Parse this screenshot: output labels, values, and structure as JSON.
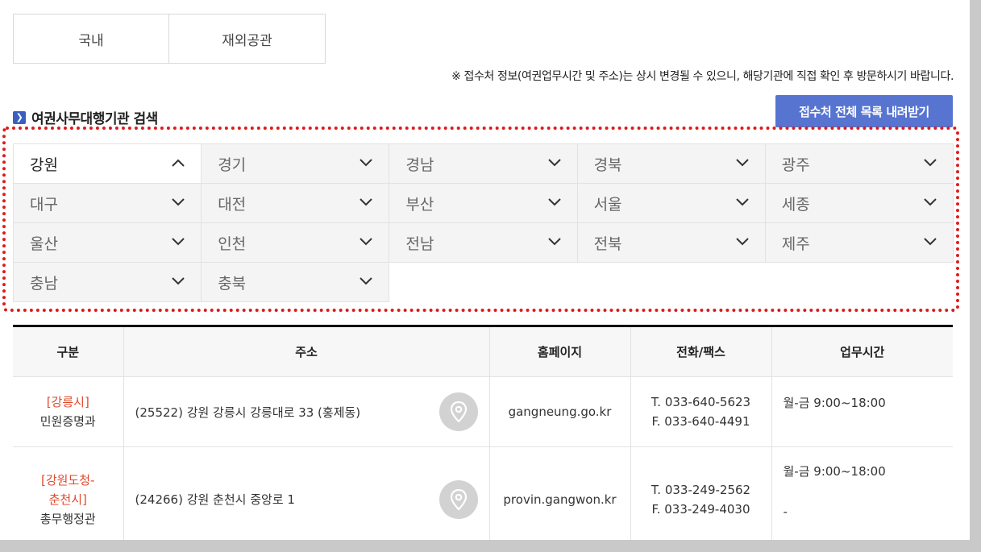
{
  "tabs": [
    {
      "label": "국내"
    },
    {
      "label": "재외공관"
    }
  ],
  "notice": "※ 접수처 정보(여권업무시간 및 주소)는 상시 변경될 수 있으니, 해당기관에 직접 확인 후 방문하시기 바랍니다.",
  "section_title": "여권사무대행기관 검색",
  "download_button": "접수처 전체 목록 내려받기",
  "regions": [
    {
      "label": "강원",
      "icon": "chevron-up-icon",
      "active": true
    },
    {
      "label": "경기",
      "icon": "chevron-down-icon"
    },
    {
      "label": "경남",
      "icon": "chevron-down-icon"
    },
    {
      "label": "경북",
      "icon": "chevron-down-icon"
    },
    {
      "label": "광주",
      "icon": "chevron-down-icon"
    },
    {
      "label": "대구",
      "icon": "chevron-down-icon"
    },
    {
      "label": "대전",
      "icon": "chevron-down-icon"
    },
    {
      "label": "부산",
      "icon": "chevron-down-icon"
    },
    {
      "label": "서울",
      "icon": "chevron-down-icon"
    },
    {
      "label": "세종",
      "icon": "chevron-down-icon"
    },
    {
      "label": "울산",
      "icon": "chevron-down-icon"
    },
    {
      "label": "인천",
      "icon": "chevron-down-icon"
    },
    {
      "label": "전남",
      "icon": "chevron-down-icon"
    },
    {
      "label": "전북",
      "icon": "chevron-down-icon"
    },
    {
      "label": "제주",
      "icon": "chevron-down-icon"
    },
    {
      "label": "충남",
      "icon": "chevron-down-icon"
    },
    {
      "label": "충북",
      "icon": "chevron-down-icon"
    }
  ],
  "table": {
    "headers": [
      "구분",
      "주소",
      "홈페이지",
      "전화/팩스",
      "업무시간"
    ],
    "rows": [
      {
        "division_tag": "[강릉시]",
        "division_name": "민원증명과",
        "address": "(25522) 강원 강릉시 강릉대로 33 (홍제동)",
        "homepage": "gangneung.go.kr",
        "tel": "T. 033-640-5623",
        "fax": "F. 033-640-4491",
        "hours": "월-금 9:00~18:00",
        "hours_extra": ""
      },
      {
        "division_tag_1": "[강원도청-",
        "division_tag_2": "춘천시]",
        "division_name": "총무행정관",
        "address": "(24266) 강원 춘천시 중앙로 1",
        "homepage": "provin.gangwon.kr",
        "tel": "T. 033-249-2562",
        "fax": "F. 033-249-4030",
        "hours": "월-금 9:00~18:00",
        "hours_extra": "-"
      }
    ]
  },
  "colors": {
    "accent": "#5674d0",
    "highlight_border": "#e01a1a",
    "division_red": "#e0492e"
  }
}
